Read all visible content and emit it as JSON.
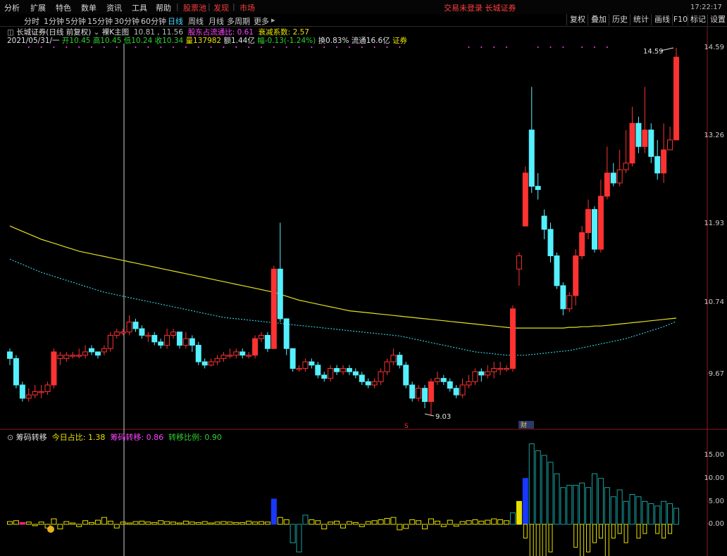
{
  "menubar": {
    "items": [
      "分析",
      "扩展",
      "特色",
      "数单",
      "资讯",
      "工具",
      "帮助"
    ],
    "highlight_items": [
      "股票池",
      "发现",
      "市场"
    ],
    "status": "交易未登录 长城证券",
    "clock": "17:22:17"
  },
  "toolbar": {
    "timeframes": [
      "分时",
      "1分钟",
      "5分钟",
      "15分钟",
      "30分钟",
      "60分钟",
      "日线",
      "周线",
      "月线",
      "多周期",
      "更多"
    ],
    "active_timeframe": "日线",
    "right_buttons": [
      "复权",
      "叠加",
      "历史",
      "统计",
      "画线",
      "F10",
      "标记",
      "设置"
    ]
  },
  "info": {
    "title": "长城证券(日线 前复权)",
    "indicator_name": "裸K主图",
    "range": "10.81 , 11.56",
    "metric1_label": "股东占流通比:",
    "metric1_value": "0.61",
    "metric2_label": "衰减系数:",
    "metric2_value": "2.57",
    "date": "2021/05/31/一",
    "open": "开10.45",
    "high": "高10.45",
    "low": "低10.24",
    "close": "收10.34",
    "volume": "量137982",
    "amount": "额1.44亿",
    "change": "幅-0.13(-1.24%)",
    "turnover": "换0.83%",
    "float": "流通16.6亿",
    "sector": "证券"
  },
  "chart_annotations": {
    "high_label": "14.59",
    "low_label": "9.03",
    "marker_s": "S",
    "marker_fin": "财"
  },
  "price_axis": [
    "14.59",
    "13.26",
    "11.93",
    "10.74",
    "9.67"
  ],
  "indicator": {
    "name": "筹码转移",
    "label1": "今日占比:",
    "value1": "1.38",
    "label2": "筹码转移:",
    "value2": "0.86",
    "label3": "转移比例:",
    "value3": "0.90"
  },
  "indicator_axis": [
    "15.00",
    "10.00",
    "5.00",
    "0.00"
  ],
  "colors": {
    "up": "#ff3232",
    "down": "#54f0ff",
    "ma_long": "#e6e01e",
    "ma_dotted": "#2ec8d8",
    "vol_yellow": "#e8e000",
    "vol_blue": "#1838ff",
    "vol_magenta": "#ff1a8c"
  },
  "chart_data": {
    "type": "candlestick",
    "y_range": [
      8.8,
      14.8
    ],
    "candles": [
      [
        10.0,
        9.9,
        10.05,
        9.8
      ],
      [
        9.9,
        9.5,
        9.95,
        9.45
      ],
      [
        9.5,
        9.3,
        9.55,
        9.25
      ],
      [
        9.3,
        9.35,
        9.45,
        9.25
      ],
      [
        9.35,
        9.4,
        9.5,
        9.3
      ],
      [
        9.4,
        9.4,
        9.5,
        9.3
      ],
      [
        9.4,
        9.5,
        9.55,
        9.35
      ],
      [
        9.5,
        10.0,
        10.05,
        9.45
      ],
      [
        9.9,
        9.95,
        10.0,
        9.8
      ],
      [
        9.9,
        9.95,
        10.0,
        9.85
      ],
      [
        9.95,
        9.95,
        10.0,
        9.9
      ],
      [
        9.95,
        9.95,
        10.05,
        9.9
      ],
      [
        9.95,
        10.0,
        10.1,
        9.9
      ],
      [
        10.05,
        10.0,
        10.1,
        9.95
      ],
      [
        10.0,
        9.95,
        10.0,
        9.9
      ],
      [
        10.0,
        10.05,
        10.1,
        9.95
      ],
      [
        10.05,
        10.25,
        10.3,
        10.0
      ],
      [
        10.25,
        10.3,
        10.35,
        10.2
      ],
      [
        10.3,
        10.3,
        10.35,
        10.25
      ],
      [
        10.3,
        10.45,
        10.55,
        10.25
      ],
      [
        10.45,
        10.35,
        10.5,
        10.3
      ],
      [
        10.35,
        10.25,
        10.4,
        10.2
      ],
      [
        10.25,
        10.25,
        10.3,
        10.15
      ],
      [
        10.25,
        10.15,
        10.3,
        10.1
      ],
      [
        10.15,
        10.1,
        10.2,
        10.05
      ],
      [
        10.1,
        10.25,
        10.35,
        10.05
      ],
      [
        10.25,
        10.3,
        10.35,
        10.2
      ],
      [
        10.3,
        10.1,
        10.3,
        10.05
      ],
      [
        10.1,
        10.2,
        10.3,
        10.05
      ],
      [
        10.2,
        10.1,
        10.25,
        10.0
      ],
      [
        10.1,
        9.85,
        10.15,
        9.8
      ],
      [
        9.85,
        9.8,
        9.9,
        9.75
      ],
      [
        9.8,
        9.85,
        9.9,
        9.78
      ],
      [
        9.85,
        9.9,
        9.95,
        9.8
      ],
      [
        9.9,
        9.95,
        10.0,
        9.85
      ],
      [
        9.95,
        9.95,
        10.05,
        9.9
      ],
      [
        9.95,
        10.0,
        10.05,
        9.9
      ],
      [
        10.0,
        9.95,
        10.05,
        9.9
      ],
      [
        9.95,
        9.95,
        10.0,
        9.9
      ],
      [
        9.95,
        10.2,
        10.25,
        9.9
      ],
      [
        10.2,
        10.25,
        10.3,
        10.15
      ],
      [
        10.25,
        10.05,
        10.3,
        10.0
      ],
      [
        10.05,
        11.25,
        11.3,
        10.05
      ],
      [
        11.25,
        10.5,
        11.95,
        10.45
      ],
      [
        10.5,
        10.05,
        10.5,
        9.95
      ],
      [
        10.05,
        9.75,
        10.05,
        9.7
      ],
      [
        9.75,
        9.75,
        9.8,
        9.7
      ],
      [
        9.75,
        9.85,
        9.9,
        9.7
      ],
      [
        9.85,
        9.8,
        9.9,
        9.75
      ],
      [
        9.8,
        9.65,
        9.85,
        9.6
      ],
      [
        9.65,
        9.6,
        9.7,
        9.55
      ],
      [
        9.6,
        9.75,
        9.8,
        9.55
      ],
      [
        9.75,
        9.7,
        9.8,
        9.65
      ],
      [
        9.7,
        9.75,
        9.8,
        9.65
      ],
      [
        9.75,
        9.7,
        9.8,
        9.65
      ],
      [
        9.7,
        9.65,
        9.75,
        9.6
      ],
      [
        9.65,
        9.55,
        9.7,
        9.5
      ],
      [
        9.55,
        9.5,
        9.6,
        9.45
      ],
      [
        9.5,
        9.55,
        9.6,
        9.45
      ],
      [
        9.55,
        9.7,
        9.75,
        9.5
      ],
      [
        9.7,
        9.85,
        9.9,
        9.65
      ],
      [
        9.85,
        9.95,
        10.05,
        9.8
      ],
      [
        9.95,
        9.8,
        10.0,
        9.75
      ],
      [
        9.8,
        9.5,
        9.85,
        9.45
      ],
      [
        9.5,
        9.3,
        9.55,
        9.25
      ],
      [
        9.3,
        9.45,
        9.5,
        9.25
      ],
      [
        9.45,
        9.25,
        9.5,
        9.15
      ],
      [
        9.25,
        9.55,
        9.6,
        9.03
      ],
      [
        9.55,
        9.6,
        9.7,
        9.5
      ],
      [
        9.6,
        9.55,
        9.65,
        9.5
      ],
      [
        9.55,
        9.45,
        9.6,
        9.4
      ],
      [
        9.45,
        9.35,
        9.5,
        9.3
      ],
      [
        9.35,
        9.5,
        9.6,
        9.3
      ],
      [
        9.5,
        9.55,
        9.65,
        9.45
      ],
      [
        9.55,
        9.7,
        9.75,
        9.5
      ],
      [
        9.7,
        9.65,
        9.75,
        9.55
      ],
      [
        9.65,
        9.7,
        9.8,
        9.6
      ],
      [
        9.7,
        9.75,
        9.85,
        9.6
      ],
      [
        9.75,
        9.75,
        9.85,
        9.65
      ],
      [
        9.75,
        9.75,
        9.8,
        9.7
      ],
      [
        9.75,
        10.65,
        10.7,
        9.7
      ],
      [
        11.25,
        11.45,
        11.5,
        11.0
      ],
      [
        11.9,
        12.7,
        12.8,
        11.9
      ],
      [
        13.35,
        12.5,
        14.0,
        12.4
      ],
      [
        12.5,
        12.45,
        12.7,
        12.3
      ],
      [
        12.05,
        11.85,
        12.15,
        11.7
      ],
      [
        11.85,
        11.45,
        11.95,
        11.35
      ],
      [
        11.45,
        11.0,
        11.5,
        10.95
      ],
      [
        11.0,
        10.65,
        11.05,
        10.55
      ],
      [
        10.65,
        10.85,
        10.9,
        10.6
      ],
      [
        10.85,
        11.45,
        11.55,
        10.7
      ],
      [
        11.45,
        11.8,
        11.9,
        11.4
      ],
      [
        11.8,
        12.15,
        12.3,
        11.7
      ],
      [
        12.15,
        11.55,
        12.2,
        11.5
      ],
      [
        11.55,
        12.35,
        12.6,
        11.5
      ],
      [
        12.35,
        12.7,
        13.1,
        12.3
      ],
      [
        12.7,
        12.55,
        12.85,
        12.5
      ],
      [
        12.55,
        12.75,
        13.05,
        12.5
      ],
      [
        12.75,
        12.85,
        13.35,
        12.7
      ],
      [
        12.85,
        13.45,
        13.7,
        12.8
      ],
      [
        13.45,
        13.1,
        13.55,
        13.0
      ],
      [
        13.1,
        13.35,
        14.0,
        13.0
      ],
      [
        13.35,
        12.95,
        13.45,
        12.85
      ],
      [
        12.95,
        12.7,
        13.2,
        12.6
      ],
      [
        12.7,
        13.05,
        13.45,
        12.55
      ],
      [
        13.05,
        13.2,
        13.4,
        13.05
      ],
      [
        13.2,
        14.45,
        14.59,
        13.25
      ]
    ],
    "ma_long": [
      11.9,
      11.86,
      11.82,
      11.78,
      11.74,
      11.7,
      11.67,
      11.64,
      11.61,
      11.58,
      11.55,
      11.52,
      11.5,
      11.48,
      11.46,
      11.44,
      11.42,
      11.4,
      11.38,
      11.36,
      11.34,
      11.32,
      11.3,
      11.28,
      11.26,
      11.24,
      11.22,
      11.2,
      11.18,
      11.16,
      11.14,
      11.12,
      11.1,
      11.08,
      11.06,
      11.04,
      11.02,
      11.0,
      10.98,
      10.96,
      10.94,
      10.92,
      10.9,
      10.87,
      10.84,
      10.81,
      10.78,
      10.76,
      10.74,
      10.72,
      10.7,
      10.68,
      10.66,
      10.64,
      10.62,
      10.61,
      10.6,
      10.59,
      10.58,
      10.57,
      10.56,
      10.55,
      10.54,
      10.53,
      10.52,
      10.51,
      10.5,
      10.49,
      10.48,
      10.47,
      10.46,
      10.45,
      10.44,
      10.43,
      10.42,
      10.41,
      10.4,
      10.39,
      10.38,
      10.37,
      10.36,
      10.36,
      10.36,
      10.36,
      10.36,
      10.36,
      10.36,
      10.36,
      10.36,
      10.37,
      10.37,
      10.38,
      10.38,
      10.39,
      10.39,
      10.4,
      10.41,
      10.42,
      10.43,
      10.44,
      10.45,
      10.46,
      10.47,
      10.48,
      10.49,
      10.5,
      10.51
    ],
    "ma_dotted": [
      11.4,
      11.36,
      11.32,
      11.28,
      11.24,
      11.2,
      11.17,
      11.14,
      11.11,
      11.08,
      11.05,
      11.02,
      10.99,
      10.96,
      10.93,
      10.9,
      10.88,
      10.86,
      10.84,
      10.82,
      10.8,
      10.78,
      10.76,
      10.74,
      10.72,
      10.7,
      10.68,
      10.66,
      10.64,
      10.62,
      10.6,
      10.58,
      10.56,
      10.54,
      10.52,
      10.51,
      10.5,
      10.49,
      10.48,
      10.47,
      10.46,
      10.45,
      10.44,
      10.43,
      10.42,
      10.41,
      10.4,
      10.39,
      10.38,
      10.37,
      10.36,
      10.35,
      10.34,
      10.33,
      10.32,
      10.31,
      10.3,
      10.29,
      10.28,
      10.27,
      10.26,
      10.25,
      10.24,
      10.22,
      10.2,
      10.18,
      10.16,
      10.14,
      10.12,
      10.1,
      10.08,
      10.06,
      10.04,
      10.02,
      10.0,
      9.99,
      9.98,
      9.97,
      9.96,
      9.95,
      9.95,
      9.95,
      9.95,
      9.96,
      9.97,
      9.98,
      9.99,
      10.0,
      10.01,
      10.02,
      10.04,
      10.06,
      10.08,
      10.1,
      10.12,
      10.14,
      10.16,
      10.18,
      10.2,
      10.23,
      10.26,
      10.29,
      10.32,
      10.35,
      10.38,
      10.42,
      10.46
    ],
    "indicator_bars": [
      0.6,
      0.8,
      0.4,
      0.5,
      -0.3,
      0.5,
      -0.8,
      1.2,
      -1.0,
      0.6,
      0.3,
      -0.5,
      0.8,
      0.4,
      0.9,
      1.5,
      0.7,
      -0.8,
      0.5,
      0.3,
      0.6,
      0.7,
      0.5,
      0.4,
      0.8,
      0.6,
      0.5,
      0.3,
      0.7,
      0.5,
      0.4,
      0.6,
      0.3,
      0.5,
      0.6,
      0.5,
      0.4,
      0.4,
      0.7,
      0.5,
      0.6,
      0.5,
      5.5,
      1.5,
      1.0,
      -4.0,
      -6.0,
      2.0,
      1.0,
      0.8,
      -1.0,
      0.5,
      0.7,
      -0.8,
      0.6,
      0.4,
      -0.5,
      0.6,
      0.8,
      1.0,
      1.3,
      1.5,
      -1.2,
      -0.9,
      1.0,
      0.8,
      -1.0,
      1.2,
      0.7,
      -0.5,
      0.9,
      -0.4,
      0.6,
      0.8,
      1.0,
      0.7,
      0.9,
      1.2,
      1.0,
      0.8,
      2.5,
      5.0,
      10.0,
      17.5,
      16.0,
      15.0,
      13.5,
      11.0,
      8.0,
      8.5,
      8.5,
      9.0,
      8.0,
      11.0,
      10.0,
      8.0,
      6.0,
      7.5,
      5.0,
      6.5,
      6.0,
      5.0,
      4.5,
      4.0,
      5.0,
      4.5,
      3.5
    ],
    "indicator_neg": [
      0,
      0,
      0,
      0,
      0,
      0,
      0,
      0,
      0,
      0,
      0,
      0,
      0,
      0,
      0,
      0,
      0,
      0,
      0,
      0,
      0,
      0,
      0,
      0,
      0,
      0,
      0,
      0,
      0,
      0,
      0,
      0,
      0,
      0,
      0,
      0,
      0,
      0,
      0,
      0,
      0,
      0,
      0,
      0,
      0,
      0,
      0,
      0,
      0,
      0,
      0,
      0,
      0,
      0,
      0,
      0,
      0,
      0,
      0,
      0,
      0,
      0,
      0,
      0,
      0,
      0,
      0,
      0,
      0,
      0,
      0,
      0,
      0,
      0,
      0,
      0,
      0,
      0,
      0,
      0,
      0,
      0,
      -3,
      -7,
      -9,
      -8,
      -6,
      0,
      0,
      0,
      -5,
      -8,
      -6,
      -4,
      -3,
      -7,
      -3,
      -2,
      -4,
      0,
      -3,
      -2,
      0,
      -2,
      -3,
      -2,
      0
    ]
  }
}
